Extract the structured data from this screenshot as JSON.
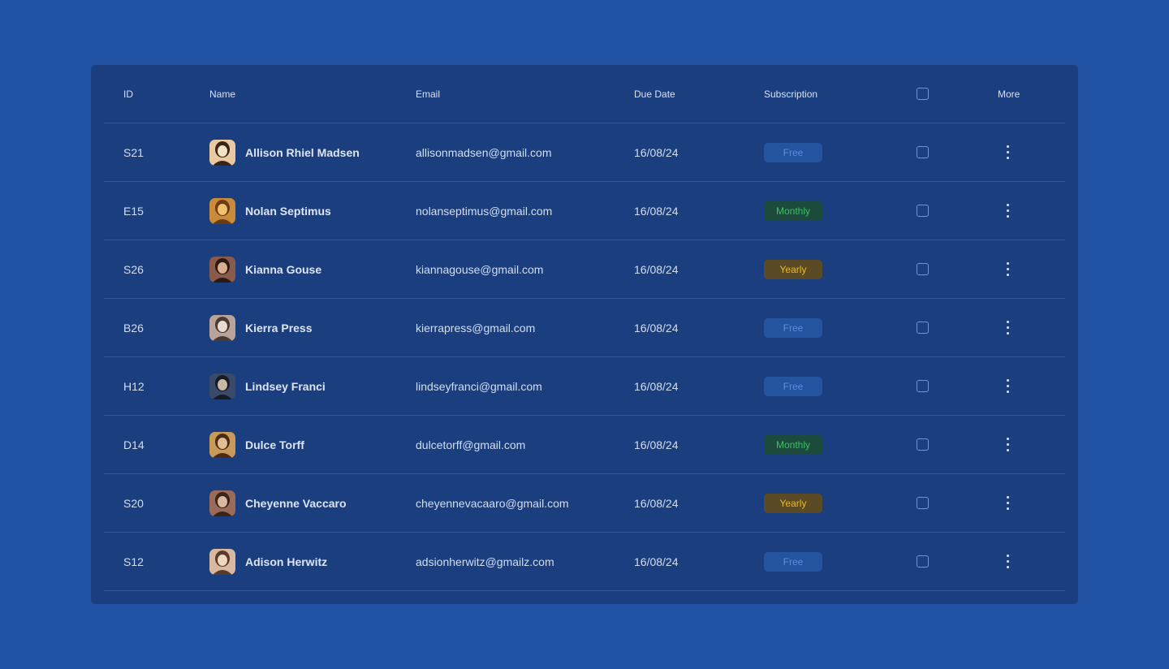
{
  "table": {
    "headers": {
      "id": "ID",
      "name": "Name",
      "email": "Email",
      "due_date": "Due Date",
      "subscription": "Subscription",
      "more": "More"
    },
    "rows": [
      {
        "id": "S21",
        "name": "Allison Rhiel Madsen",
        "email": "allisonmadsen@gmail.com",
        "due_date": "16/08/24",
        "subscription": "Free",
        "subscription_type": "free",
        "checked": false,
        "avatar": "avatar-photo"
      },
      {
        "id": "E15",
        "name": "Nolan Septimus",
        "email": "nolanseptimus@gmail.com",
        "due_date": "16/08/24",
        "subscription": "Monthly",
        "subscription_type": "monthly",
        "checked": false,
        "avatar": "avatar-photo"
      },
      {
        "id": "S26",
        "name": "Kianna Gouse",
        "email": "kiannagouse@gmail.com",
        "due_date": "16/08/24",
        "subscription": "Yearly",
        "subscription_type": "yearly",
        "checked": false,
        "avatar": "avatar-photo"
      },
      {
        "id": "B26",
        "name": "Kierra Press",
        "email": "kierrapress@gmail.com",
        "due_date": "16/08/24",
        "subscription": "Free",
        "subscription_type": "free",
        "checked": false,
        "avatar": "avatar-photo"
      },
      {
        "id": "H12",
        "name": "Lindsey Franci",
        "email": "lindseyfranci@gmail.com",
        "due_date": "16/08/24",
        "subscription": "Free",
        "subscription_type": "free",
        "checked": false,
        "avatar": "avatar-photo"
      },
      {
        "id": "D14",
        "name": "Dulce Torff",
        "email": "dulcetorff@gmail.com",
        "due_date": "16/08/24",
        "subscription": "Monthly",
        "subscription_type": "monthly",
        "checked": false,
        "avatar": "avatar-photo"
      },
      {
        "id": "S20",
        "name": "Cheyenne Vaccaro",
        "email": "cheyennevacaaro@gmail.com",
        "due_date": "16/08/24",
        "subscription": "Yearly",
        "subscription_type": "yearly",
        "checked": false,
        "avatar": "avatar-photo"
      },
      {
        "id": "S12",
        "name": "Adison Herwitz",
        "email": "adsionherwitz@gmailz.com",
        "due_date": "16/08/24",
        "subscription": "Free",
        "subscription_type": "free",
        "checked": false,
        "avatar": "avatar-photo"
      }
    ]
  },
  "colors": {
    "page_background": "#2152a3",
    "card_background": "#1b3e7f",
    "divider": "#2d5ab0",
    "free_badge_bg": "#24539f",
    "free_badge_text": "#5a8ee0",
    "monthly_badge_bg": "#1c4a3b",
    "monthly_badge_text": "#3bc16a",
    "yearly_badge_bg": "#5a4a26",
    "yearly_badge_text": "#e9bb2b"
  },
  "icons": {
    "row_menu": "more-vertical-icon",
    "select": "checkbox-icon"
  }
}
